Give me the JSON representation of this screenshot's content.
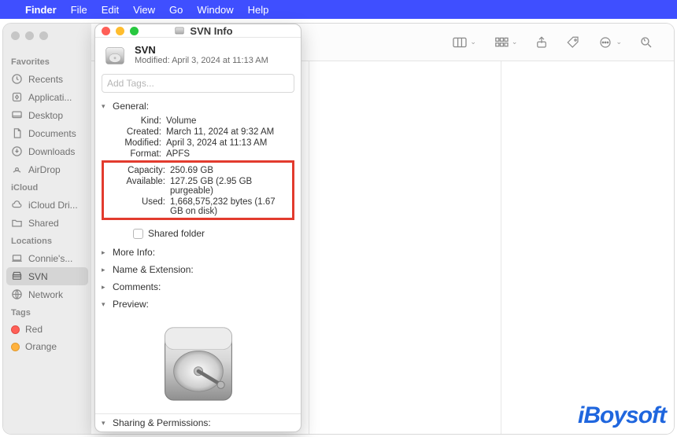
{
  "menubar": {
    "app": "Finder",
    "items": [
      "File",
      "Edit",
      "View",
      "Go",
      "Window",
      "Help"
    ]
  },
  "sidebar": {
    "groups": [
      {
        "header": "Favorites",
        "items": [
          {
            "label": "Recents",
            "icon": "clock"
          },
          {
            "label": "Applicati...",
            "icon": "app"
          },
          {
            "label": "Desktop",
            "icon": "desktop"
          },
          {
            "label": "Documents",
            "icon": "doc"
          },
          {
            "label": "Downloads",
            "icon": "download"
          },
          {
            "label": "AirDrop",
            "icon": "airdrop"
          }
        ]
      },
      {
        "header": "iCloud",
        "items": [
          {
            "label": "iCloud Dri...",
            "icon": "cloud"
          },
          {
            "label": "Shared",
            "icon": "folder"
          }
        ]
      },
      {
        "header": "Locations",
        "items": [
          {
            "label": "Connie's...",
            "icon": "laptop"
          },
          {
            "label": "SVN",
            "icon": "disk",
            "selected": true
          },
          {
            "label": "Network",
            "icon": "globe"
          }
        ]
      },
      {
        "header": "Tags",
        "items": [
          {
            "label": "Red",
            "tag": "red"
          },
          {
            "label": "Orange",
            "tag": "orange"
          }
        ]
      }
    ]
  },
  "info": {
    "title": "SVN Info",
    "name": "SVN",
    "modified_line": "Modified: April 3, 2024 at 11:13 AM",
    "tags_placeholder": "Add Tags...",
    "sections": {
      "general": {
        "label": "General:",
        "rows": [
          {
            "k": "Kind:",
            "v": "Volume"
          },
          {
            "k": "Created:",
            "v": "March 11, 2024 at 9:32 AM"
          },
          {
            "k": "Modified:",
            "v": "April 3, 2024 at 11:13 AM"
          },
          {
            "k": "Format:",
            "v": "APFS"
          }
        ],
        "highlight_rows": [
          {
            "k": "Capacity:",
            "v": "250.69 GB"
          },
          {
            "k": "Available:",
            "v": "127.25 GB (2.95 GB purgeable)"
          },
          {
            "k": "Used:",
            "v": "1,668,575,232 bytes (1.67 GB on disk)"
          }
        ],
        "shared_label": "Shared folder"
      },
      "more_info": "More Info:",
      "name_ext": "Name & Extension:",
      "comments": "Comments:",
      "preview": "Preview:",
      "sharing": "Sharing & Permissions:"
    }
  },
  "watermark": "iBoysoft"
}
